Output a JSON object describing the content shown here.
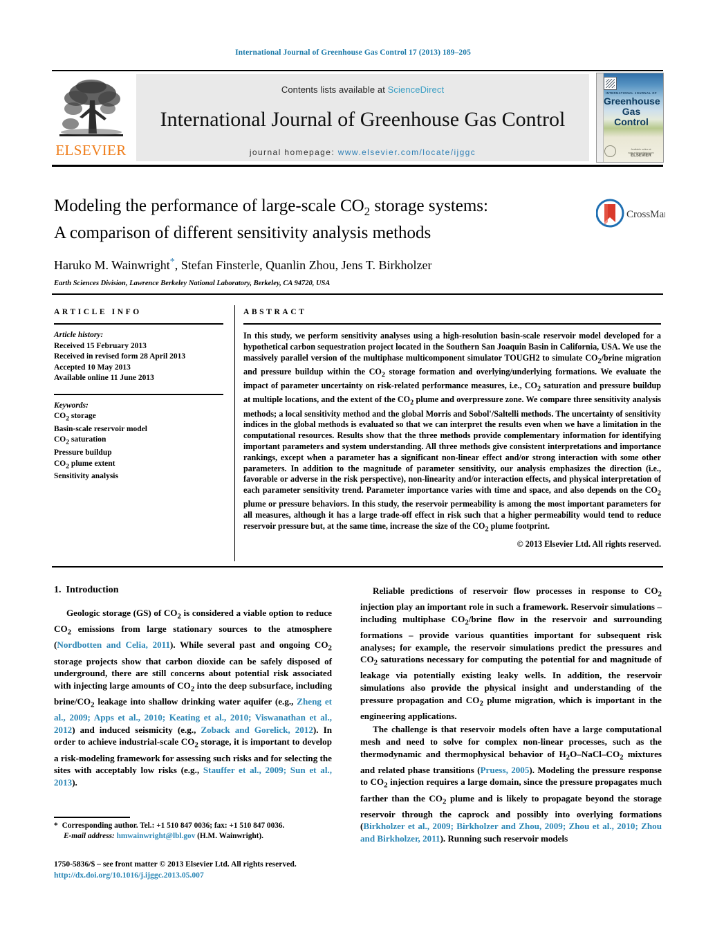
{
  "running_head": "International Journal of Greenhouse Gas Control 17 (2013) 189–205",
  "masthead": {
    "publisher_name": "ELSEVIER",
    "contents_prefix": "Contents lists available at ",
    "contents_link": "ScienceDirect",
    "journal_title": "International Journal of Greenhouse Gas Control",
    "homepage_label": "journal homepage:",
    "homepage_url": "www.elsevier.com/locate/ijggc",
    "cover": {
      "kicker": "INTERNATIONAL JOURNAL OF",
      "title_line1": "Greenhouse",
      "title_line2": "Gas Control",
      "foot_brand": "ELSEVIER",
      "foot_note": "Available online at www.sciencedirect.com"
    }
  },
  "article": {
    "title_line1_pre": "Modeling the performance of large-scale CO",
    "title_line1_sub": "2",
    "title_line1_post": " storage systems:",
    "title_line2": "A comparison of different sensitivity analysis methods",
    "authors": "Haruko M. Wainwright",
    "authors_rest": ", Stefan Finsterle, Quanlin Zhou, Jens T. Birkholzer",
    "corresponding_marker": "*",
    "affiliation": "Earth Sciences Division, Lawrence Berkeley National Laboratory, Berkeley, CA 94720, USA",
    "crossmark_label": "CrossMark"
  },
  "article_info": {
    "heading": "ARTICLE INFO",
    "history_label": "Article history:",
    "history": [
      "Received 15 February 2013",
      "Received in revised form 28 April 2013",
      "Accepted 10 May 2013",
      "Available online 11 June 2013"
    ],
    "keywords_label": "Keywords:",
    "keywords_html": "CO<sub>2</sub> storage<br>Basin-scale reservoir model<br>CO<sub>2</sub> saturation<br>Pressure buildup<br>CO<sub>2</sub> plume extent<br>Sensitivity analysis"
  },
  "abstract": {
    "heading": "ABSTRACT",
    "text_html": "In this study, we perform sensitivity analyses using a high-resolution basin-scale reservoir model developed for a hypothetical carbon sequestration project located in the Southern San Joaquin Basin in California, USA. We use the massively parallel version of the multiphase multicomponent simulator TOUGH2 to simulate CO<sub>2</sub>/brine migration and pressure buildup within the CO<sub>2</sub> storage formation and overlying/underlying formations. We evaluate the impact of parameter uncertainty on risk-related performance measures, i.e., CO<sub>2</sub> saturation and pressure buildup at multiple locations, and the extent of the CO<sub>2</sub> plume and overpressure zone. We compare three sensitivity analysis methods; a local sensitivity method and the global Morris and Sobol'/Saltelli methods. The uncertainty of sensitivity indices in the global methods is evaluated so that we can interpret the results even when we have a limitation in the computational resources. Results show that the three methods provide complementary information for identifying important parameters and system understanding. All three methods give consistent interpretations and importance rankings, except when a parameter has a significant non-linear effect and/or strong interaction with some other parameters. In addition to the magnitude of parameter sensitivity, our analysis emphasizes the direction (i.e., favorable or adverse in the risk perspective), non-linearity and/or interaction effects, and physical interpretation of each parameter sensitivity trend. Parameter importance varies with time and space, and also depends on the CO<sub>2</sub> plume or pressure behaviors. In this study, the reservoir permeability is among the most important parameters for all measures, although it has a large trade-off effect in risk such that a higher permeability would tend to reduce reservoir pressure but, at the same time, increase the size of the CO<sub>2</sub> plume footprint.",
    "copyright": "© 2013 Elsevier Ltd. All rights reserved."
  },
  "body": {
    "section1_number": "1.",
    "section1_title": "Introduction",
    "left_paragraph_1_html": "Geologic storage (GS) of CO<sub>2</sub> is considered a viable option to reduce CO<sub>2</sub> emissions from large stationary sources to the atmosphere (<span class=\"cite\">Nordbotten and Celia, 2011</span>). While several past and ongoing CO<sub>2</sub> storage projects show that carbon dioxide can be safely disposed of underground, there are still concerns about potential risk associated with injecting large amounts of CO<sub>2</sub> into the deep subsurface, including brine/CO<sub>2</sub> leakage into shallow drinking water aquifer (e.g., <span class=\"cite\">Zheng et al., 2009; Apps et al., 2010; Keating et al., 2010; Viswanathan et al., 2012</span>) and induced seismicity (e.g., <span class=\"cite\">Zoback and Gorelick, 2012</span>). In order to achieve industrial-scale CO<sub>2</sub> storage, it is important to develop a risk-modeling framework for assessing such risks and for selecting the sites with acceptably low risks (e.g., <span class=\"cite\">Stauffer et al., 2009; Sun et al., 2013</span>).",
    "right_paragraph_1_html": "Reliable predictions of reservoir flow processes in response to CO<sub>2</sub> injection play an important role in such a framework. Reservoir simulations – including multiphase CO<sub>2</sub>/brine flow in the reservoir and surrounding formations – provide various quantities important for subsequent risk analyses; for example, the reservoir simulations predict the pressures and CO<sub>2</sub> saturations necessary for computing the potential for and magnitude of leakage via potentially existing leaky wells. In addition, the reservoir simulations also provide the physical insight and understanding of the pressure propagation and CO<sub>2</sub> plume migration, which is important in the engineering applications.",
    "right_paragraph_2_html": "The challenge is that reservoir models often have a large computational mesh and need to solve for complex non-linear processes, such as the thermodynamic and thermophysical behavior of H<sub>2</sub>O–NaCl–CO<sub>2</sub> mixtures and related phase transitions (<span class=\"cite\">Pruess, 2005</span>). Modeling the pressure response to CO<sub>2</sub> injection requires a large domain, since the pressure propagates much farther than the CO<sub>2</sub> plume and is likely to propagate beyond the storage reservoir through the caprock and possibly into overlying formations (<span class=\"cite\">Birkholzer et al., 2009; Birkholzer and Zhou, 2009; Zhou et al., 2010; Zhou and Birkholzer, 2011</span>). Running such reservoir models"
  },
  "footnote": {
    "star": "*",
    "corresponding_text": "Corresponding author. Tel.: +1 510 847 0036; fax: +1 510 847 0036.",
    "email_label": "E-mail address:",
    "email": "hmwainwright@lbl.gov",
    "email_owner": "(H.M. Wainwright)."
  },
  "imprint": {
    "issn_line": "1750-5836/$ – see front matter © 2013 Elsevier Ltd. All rights reserved.",
    "doi": "http://dx.doi.org/10.1016/j.ijggc.2013.05.007"
  },
  "colors": {
    "link_blue": "#2b86b5",
    "header_blue": "#1878a8",
    "elsevier_orange": "#ef7d1a",
    "sciencedirect_blue": "#3a9ec4"
  }
}
